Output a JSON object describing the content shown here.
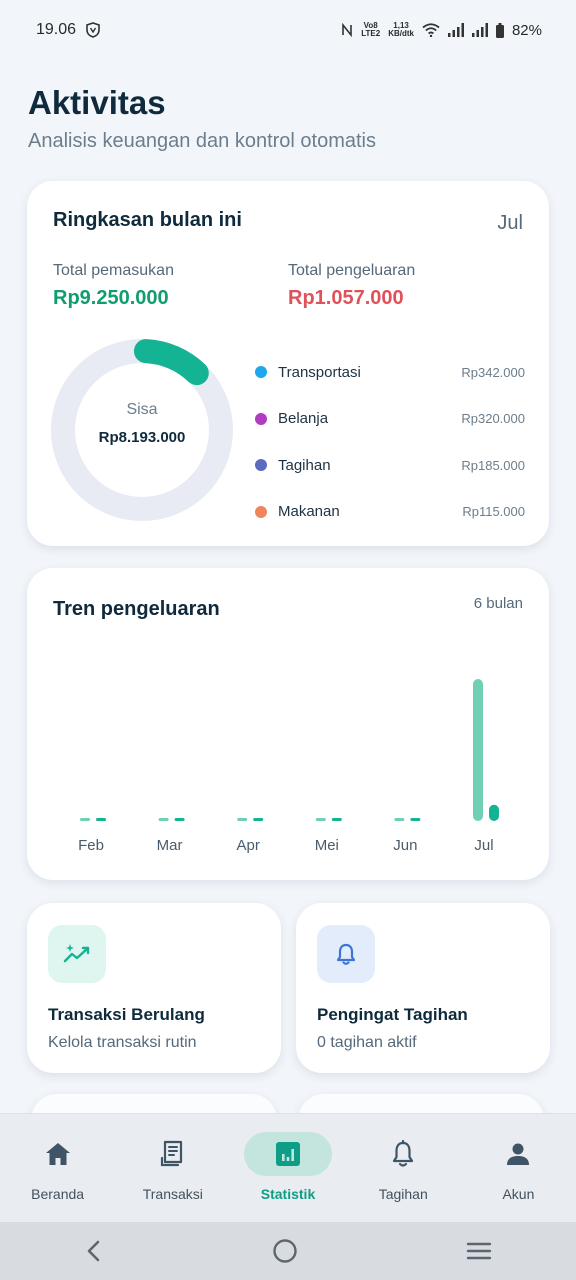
{
  "status": {
    "time": "19.06",
    "net_top": "1,13",
    "net_bottom": "KB/dtk",
    "lte_top": "Vo8",
    "lte_bottom": "LTE2",
    "battery": "82%"
  },
  "header": {
    "title": "Aktivitas",
    "subtitle": "Analisis keuangan dan kontrol otomatis"
  },
  "summary": {
    "title": "Ringkasan bulan ini",
    "month": "Jul",
    "income_label": "Total pemasukan",
    "income_value": "Rp9.250.000",
    "expense_label": "Total pengeluaran",
    "expense_value": "Rp1.057.000",
    "remaining_label": "Sisa",
    "remaining_value": "Rp8.193.000",
    "spent_fraction": 0.114,
    "categories": [
      {
        "name": "Transportasi",
        "value": "Rp342.000",
        "color": "#1ea7ec"
      },
      {
        "name": "Belanja",
        "value": "Rp320.000",
        "color": "#b13cc2"
      },
      {
        "name": "Tagihan",
        "value": "Rp185.000",
        "color": "#5c6bc0"
      },
      {
        "name": "Makanan",
        "value": "Rp115.000",
        "color": "#f0845a"
      }
    ]
  },
  "chart_data": {
    "type": "bar",
    "title": "Tren pengeluaran",
    "period": "6 bulan",
    "categories": [
      "Feb",
      "Mar",
      "Apr",
      "Mei",
      "Jun",
      "Jul"
    ],
    "series": [
      {
        "values": [
          0,
          0,
          0,
          0,
          0,
          9250000
        ],
        "color": "#6fd0b6"
      },
      {
        "values": [
          0,
          0,
          0,
          0,
          0,
          1057000
        ],
        "color": "#14b394"
      }
    ],
    "ylim": [
      0,
      9250000
    ]
  },
  "features": [
    {
      "title": "Transaksi Berulang",
      "subtitle": "Kelola transaksi rutin",
      "icon": "sparkle-trend-icon"
    },
    {
      "title": "Pengingat Tagihan",
      "subtitle": "0 tagihan aktif",
      "icon": "bell-icon"
    }
  ],
  "nav": [
    {
      "label": "Beranda",
      "icon": "home-icon"
    },
    {
      "label": "Transaksi",
      "icon": "receipt-icon"
    },
    {
      "label": "Statistik",
      "icon": "chart-icon",
      "active": true
    },
    {
      "label": "Tagihan",
      "icon": "bell-icon"
    },
    {
      "label": "Akun",
      "icon": "person-icon"
    }
  ],
  "colors": {
    "accent": "#14b394",
    "income": "#109e6e",
    "expense": "#e0525a"
  }
}
